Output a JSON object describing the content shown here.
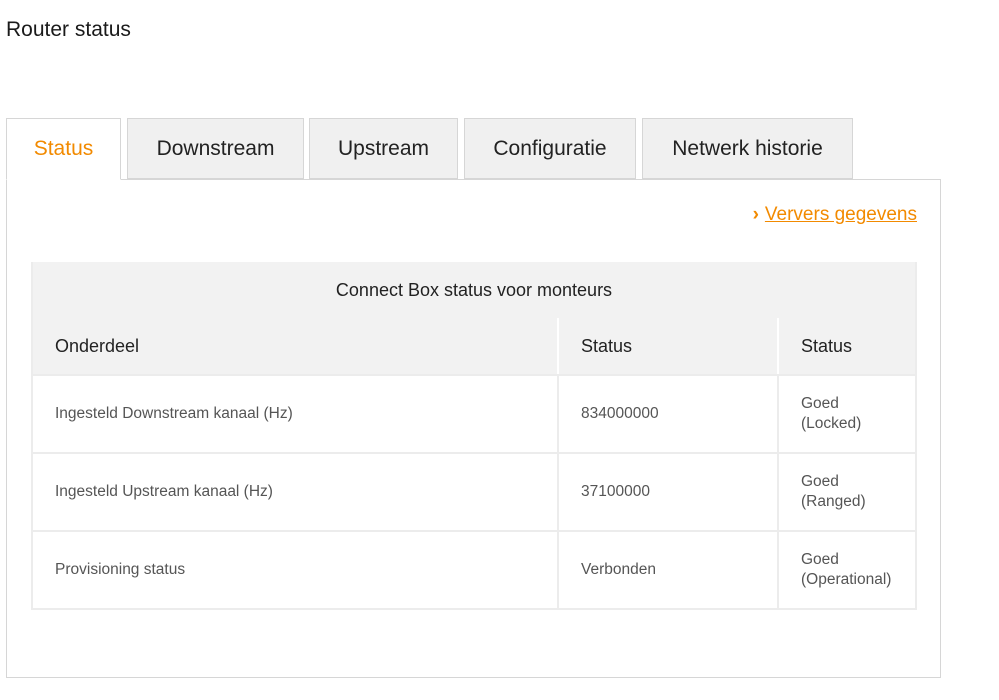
{
  "page": {
    "title": "Router status"
  },
  "tabs": [
    {
      "label": "Status",
      "active": true
    },
    {
      "label": "Downstream",
      "active": false
    },
    {
      "label": "Upstream",
      "active": false
    },
    {
      "label": "Configuratie",
      "active": false
    },
    {
      "label": "Netwerk historie",
      "active": false
    }
  ],
  "refresh": {
    "label": "Ververs gegevens",
    "icon": "chevron-right-icon"
  },
  "table": {
    "caption": "Connect Box status voor monteurs",
    "headers": [
      "Onderdeel",
      "Status",
      "Status"
    ],
    "rows": [
      {
        "item": "Ingesteld Downstream kanaal (Hz)",
        "value": "834000000",
        "state": "Goed",
        "detail": "(Locked)"
      },
      {
        "item": "Ingesteld Upstream kanaal (Hz)",
        "value": "37100000",
        "state": "Goed",
        "detail": "(Ranged)"
      },
      {
        "item": "Provisioning status",
        "value": "Verbonden",
        "state": "Goed",
        "detail": "(Operational)"
      }
    ]
  },
  "colors": {
    "accent": "#f28a00",
    "tab_inactive_bg": "#f0f0f0",
    "table_header_bg": "#f2f2f2"
  }
}
